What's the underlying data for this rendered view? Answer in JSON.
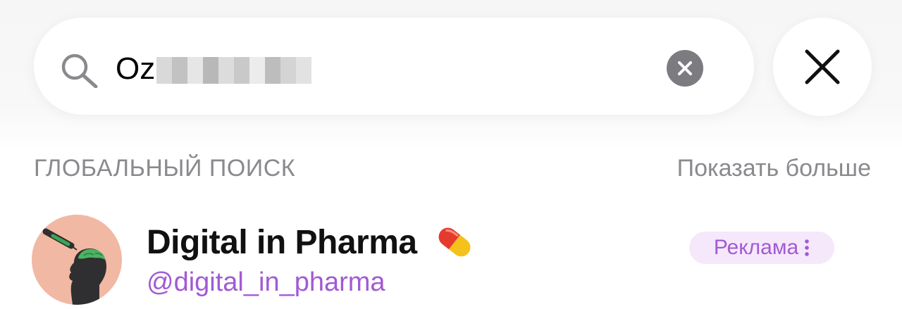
{
  "search": {
    "query": "Oz",
    "query_redacted": true
  },
  "section": {
    "title": "ГЛОБАЛЬНЫЙ ПОИСК",
    "show_more": "Показать больше"
  },
  "result": {
    "name": "Digital in Pharma",
    "handle": "@digital_in_pharma",
    "badge": "Реклама",
    "avatar_icon": "brain-head-icon",
    "emoji_icon": "pill-icon"
  },
  "icons": {
    "search": "search-icon",
    "clear": "clear-icon",
    "close": "close-icon",
    "menu": "more-vertical-icon"
  },
  "colors": {
    "accent": "#a25ad4",
    "badge_bg": "#f5e8fb",
    "muted_text": "#8a8a8e",
    "clear_button": "#7c7c80"
  }
}
